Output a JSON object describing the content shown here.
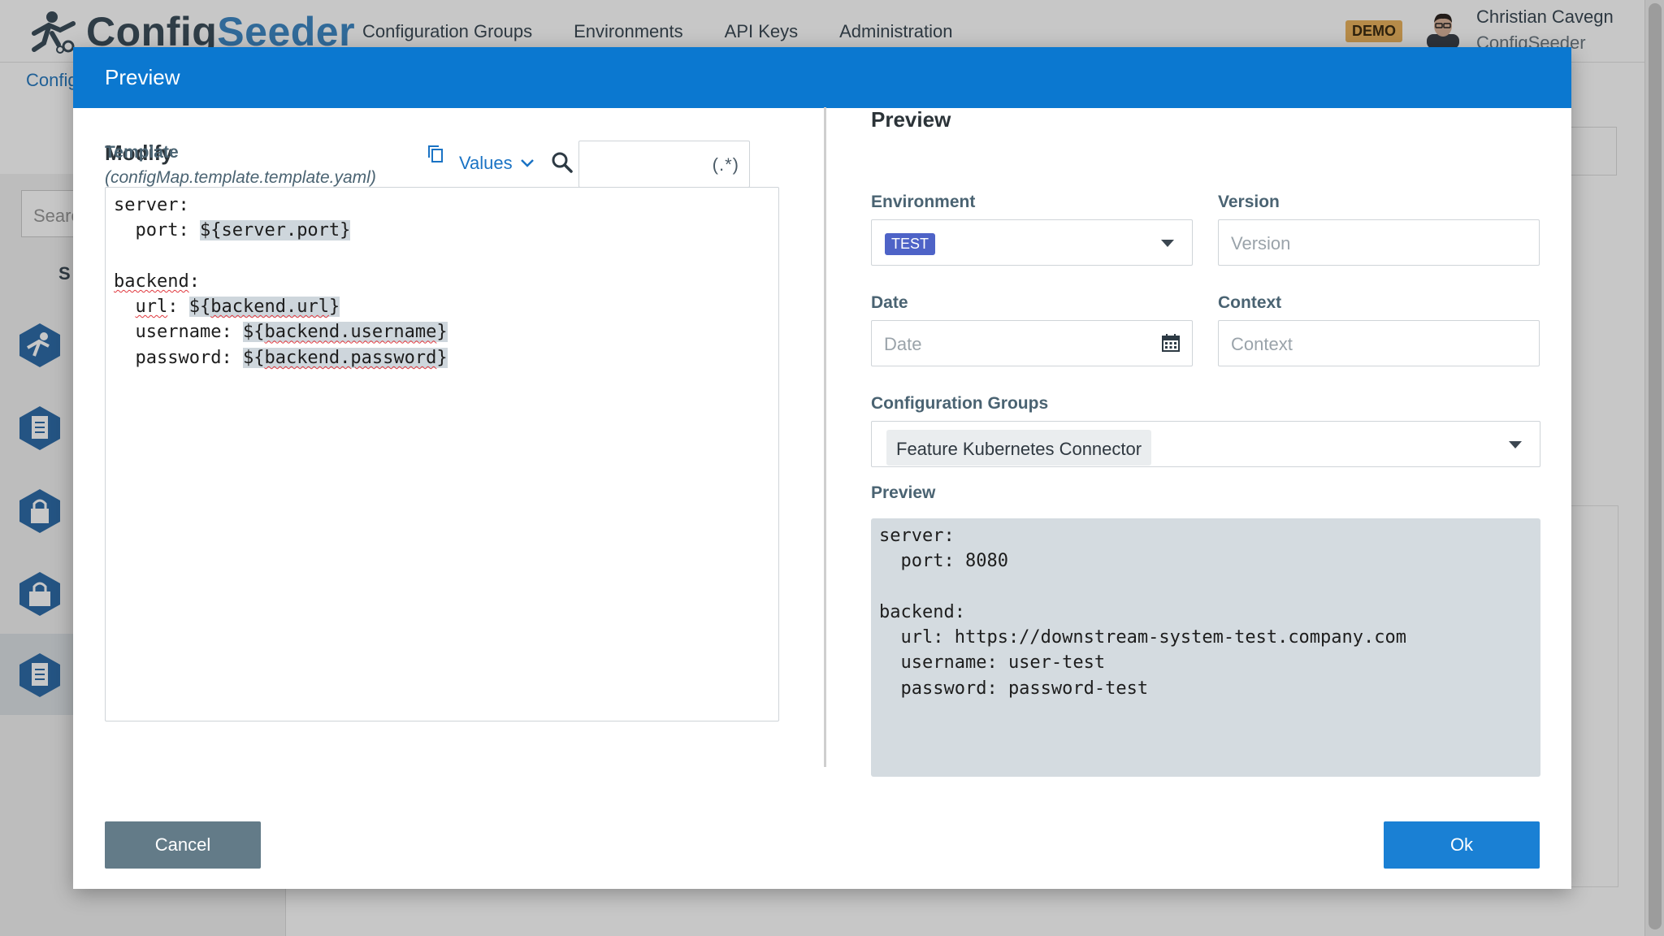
{
  "app": {
    "logo_part1": "Config",
    "logo_part2": "Seeder",
    "nav": [
      "Configuration Groups",
      "Environments",
      "API Keys",
      "Administration"
    ],
    "badge": "DEMO",
    "user_name": "Christian Cavegn",
    "user_org": "ConfigSeeder",
    "breadcrumb": "Config",
    "search_placeholder": "Searc",
    "sort_label": "S"
  },
  "modal": {
    "title": "Preview",
    "modify": {
      "heading": "Modify",
      "template_label": "Template",
      "template_file": "(configMap.template.template.yaml)",
      "values_label": "Values",
      "regex_suffix": "(.*)",
      "template_lines": [
        "server:",
        "  port: ${server.port}",
        "",
        "backend:",
        "  url: ${backend.url}",
        "  username: ${backend.username}",
        "  password: ${backend.password}"
      ]
    },
    "preview": {
      "heading": "Preview",
      "environment_label": "Environment",
      "environment_value": "TEST",
      "version_label": "Version",
      "version_placeholder": "Version",
      "date_label": "Date",
      "date_placeholder": "Date",
      "context_label": "Context",
      "context_placeholder": "Context",
      "groups_label": "Configuration Groups",
      "group_chip": "Feature Kubernetes Connector",
      "output_label": "Preview",
      "output_lines": [
        "server:",
        "  port: 8080",
        "",
        "backend:",
        "  url: https://downstream-system-test.company.com",
        "  username: user-test",
        "  password: password-test"
      ]
    },
    "cancel_label": "Cancel",
    "ok_label": "Ok"
  },
  "colors": {
    "header_blue": "#0b78d0",
    "env_tag": "#4e63c7",
    "ok_button": "#1a80d4",
    "cancel_button": "#637b88",
    "preview_bg": "#d4dbe0"
  }
}
